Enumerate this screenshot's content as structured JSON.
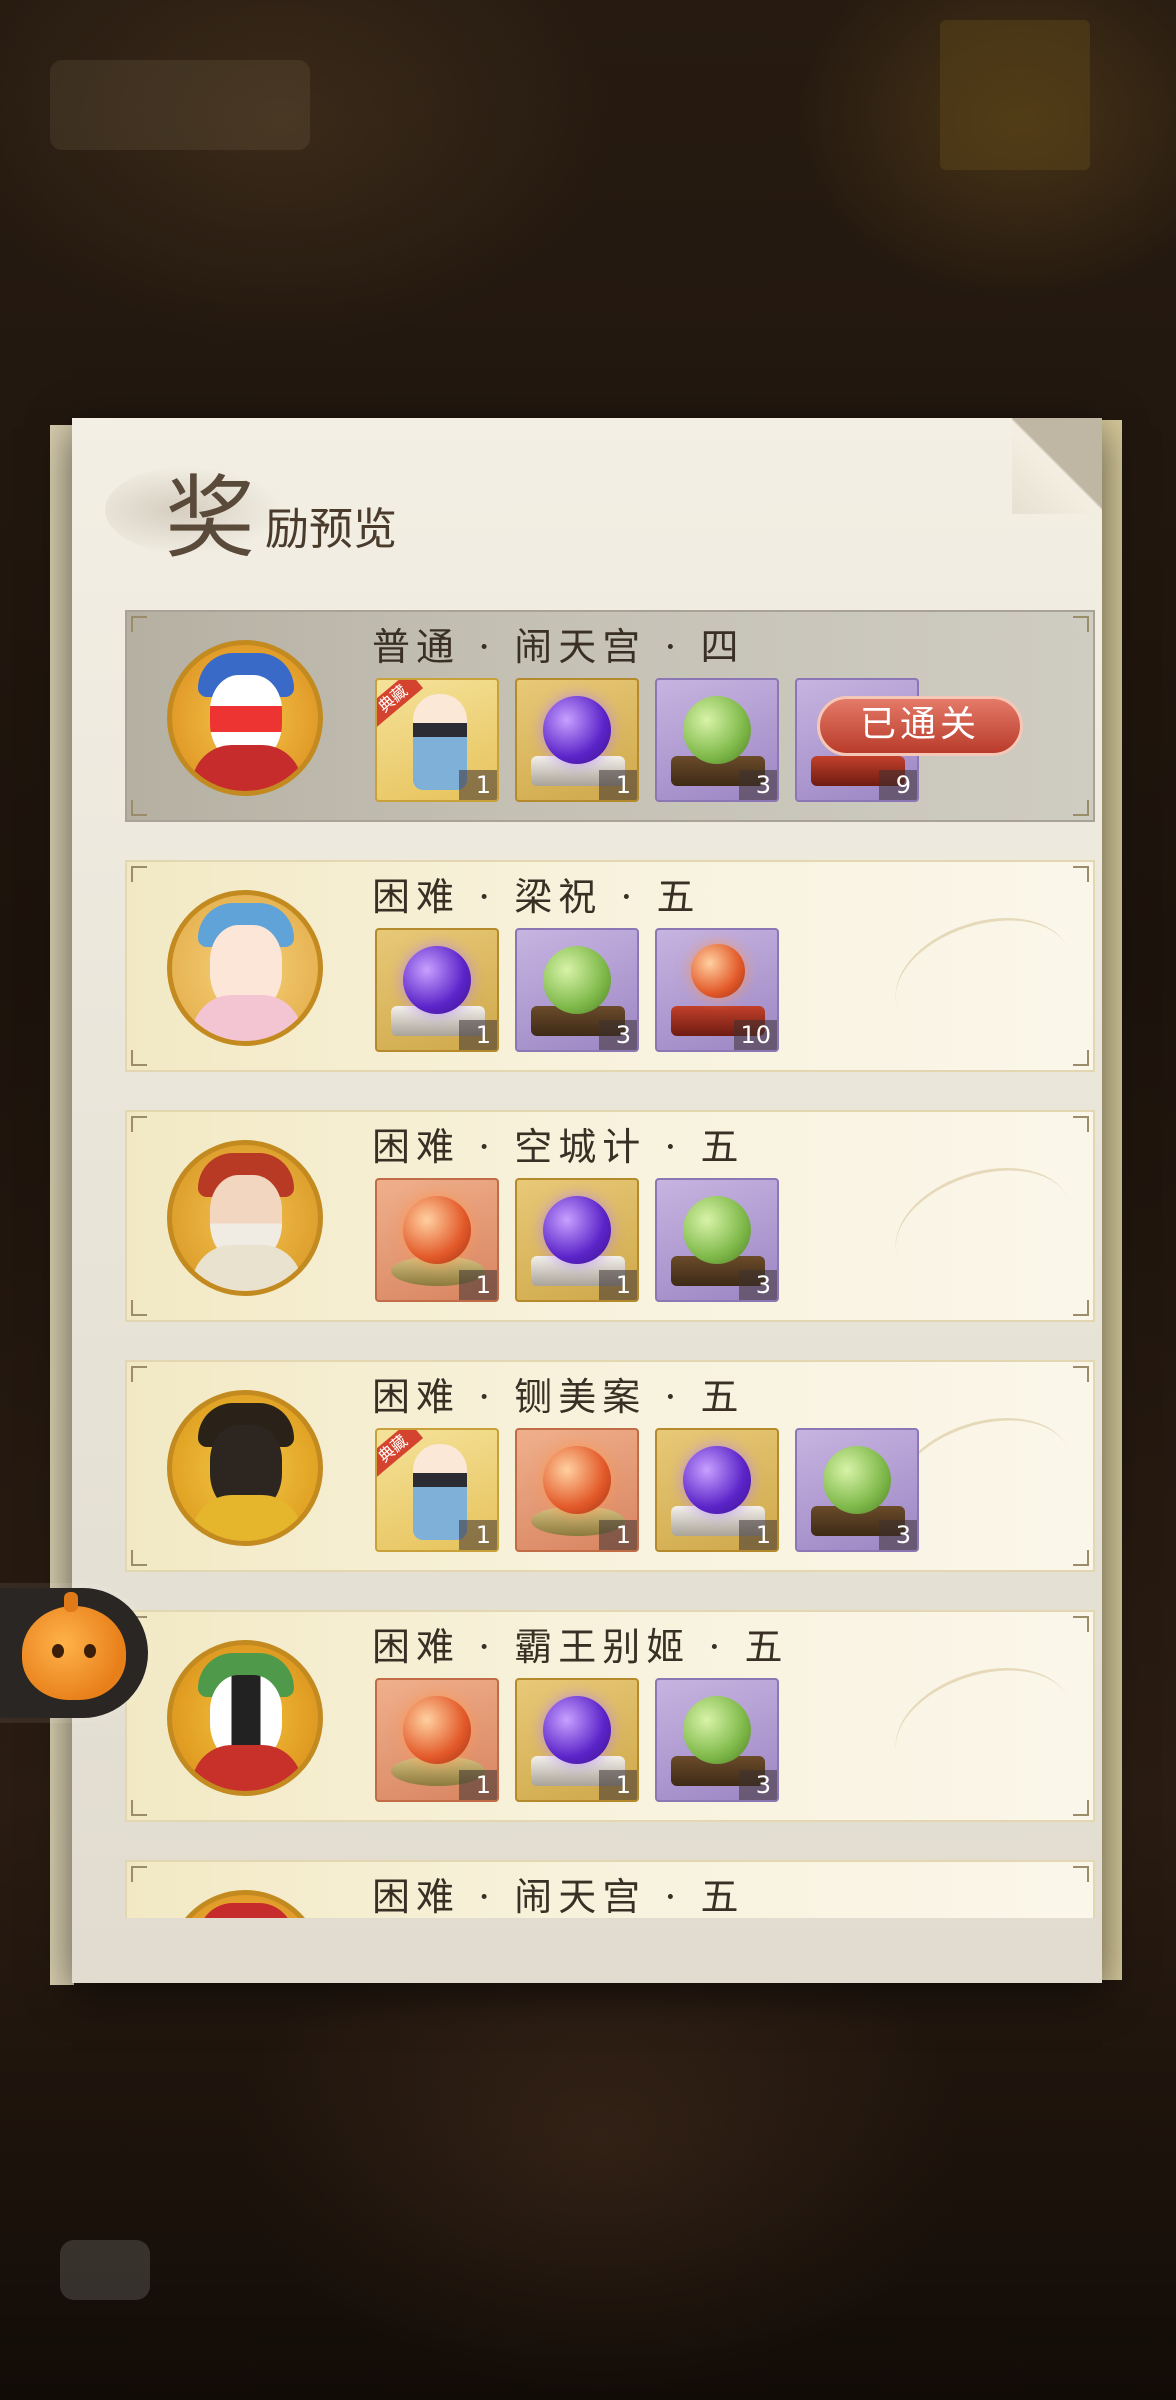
{
  "panel": {
    "title_big": "奖",
    "title_small": "励预览"
  },
  "stages": [
    {
      "title": "普通 · 闹天宫 · 四",
      "cleared": true,
      "status_label": "已通关",
      "rewards": [
        {
          "kind": "character",
          "tag": "典藏",
          "count": "1"
        },
        {
          "kind": "purple-orb",
          "count": "1"
        },
        {
          "kind": "green-orb",
          "count": "3"
        },
        {
          "kind": "red-chest",
          "count": "9"
        }
      ]
    },
    {
      "title": "困难 · 梁祝 · 五",
      "cleared": false,
      "rewards": [
        {
          "kind": "purple-orb",
          "count": "1"
        },
        {
          "kind": "green-orb",
          "count": "3"
        },
        {
          "kind": "red-chest",
          "count": "10"
        }
      ]
    },
    {
      "title": "困难 · 空城计 · 五",
      "cleared": false,
      "rewards": [
        {
          "kind": "red-orb",
          "count": "1"
        },
        {
          "kind": "purple-orb",
          "count": "1"
        },
        {
          "kind": "green-orb",
          "count": "3"
        }
      ]
    },
    {
      "title": "困难 · 铡美案 · 五",
      "cleared": false,
      "rewards": [
        {
          "kind": "character",
          "tag": "典藏",
          "count": "1"
        },
        {
          "kind": "red-orb",
          "count": "1"
        },
        {
          "kind": "purple-orb",
          "count": "1"
        },
        {
          "kind": "green-orb",
          "count": "3"
        }
      ]
    },
    {
      "title": "困难 · 霸王别姬 · 五",
      "cleared": false,
      "rewards": [
        {
          "kind": "red-orb",
          "count": "1"
        },
        {
          "kind": "purple-orb",
          "count": "1"
        },
        {
          "kind": "green-orb",
          "count": "3"
        }
      ]
    },
    {
      "title": "困难 · 闹天宫 · 五",
      "cleared": false,
      "rewards": []
    }
  ],
  "colors": {
    "accent_red": "#b93b2b",
    "gold_border": "#c38a1f",
    "item_purple": "#9c86c4"
  },
  "icons": {
    "floating_button": "pumpkin-mascot-icon"
  }
}
